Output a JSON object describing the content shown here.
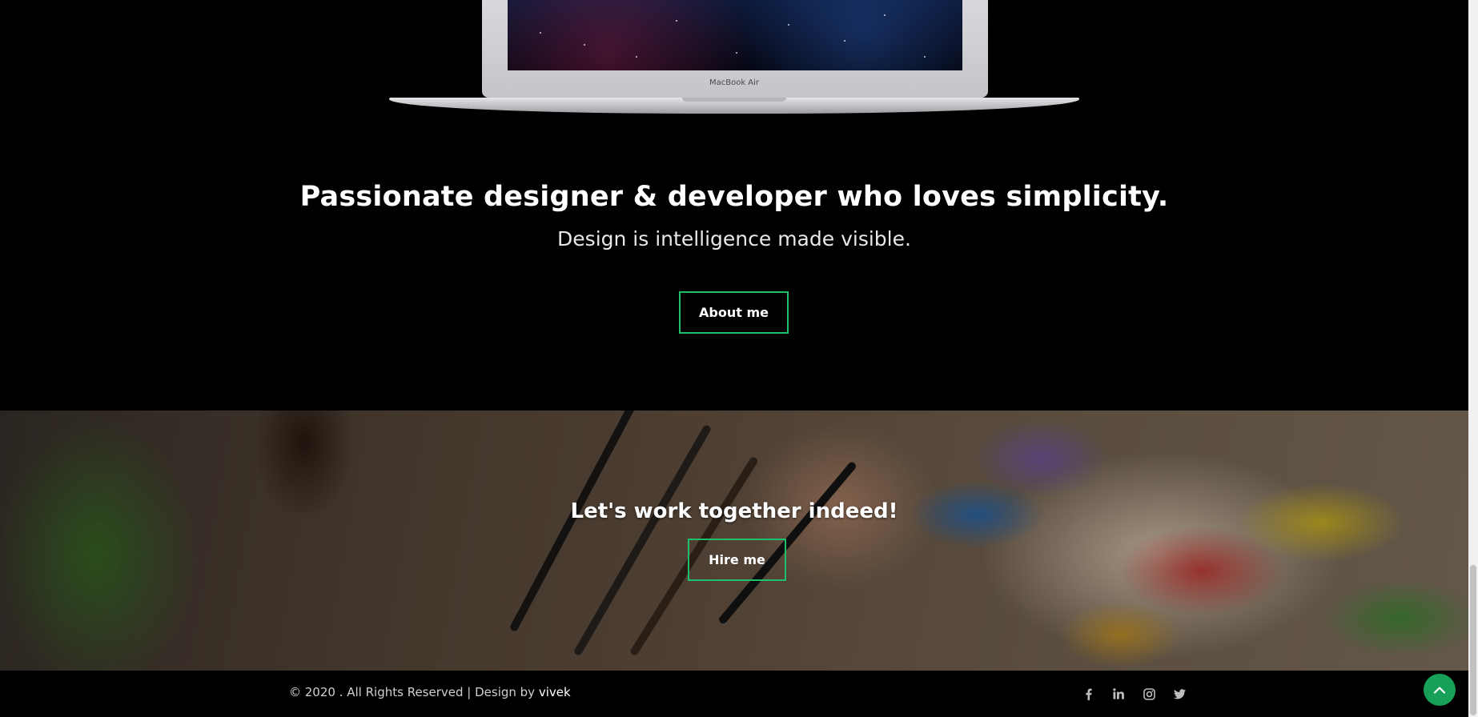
{
  "hero": {
    "laptop_brand": "MacBook Air",
    "headline": "Passionate designer & developer who loves simplicity.",
    "subline": "Design is intelligence made visible.",
    "about_button": "About me"
  },
  "banner": {
    "title": "Let's work together indeed!",
    "hire_button": "Hire me"
  },
  "footer": {
    "copyright_prefix": "© 2020 . All Rights Reserved | Design by ",
    "author": "vivek",
    "social_icons": [
      "facebook-icon",
      "linkedin-icon",
      "instagram-icon",
      "twitter-icon"
    ]
  },
  "scroll_top_icon": "chevron-up-icon",
  "colors": {
    "accent": "#1fbf6e",
    "scroll_top": "#16a058",
    "background": "#000000"
  }
}
